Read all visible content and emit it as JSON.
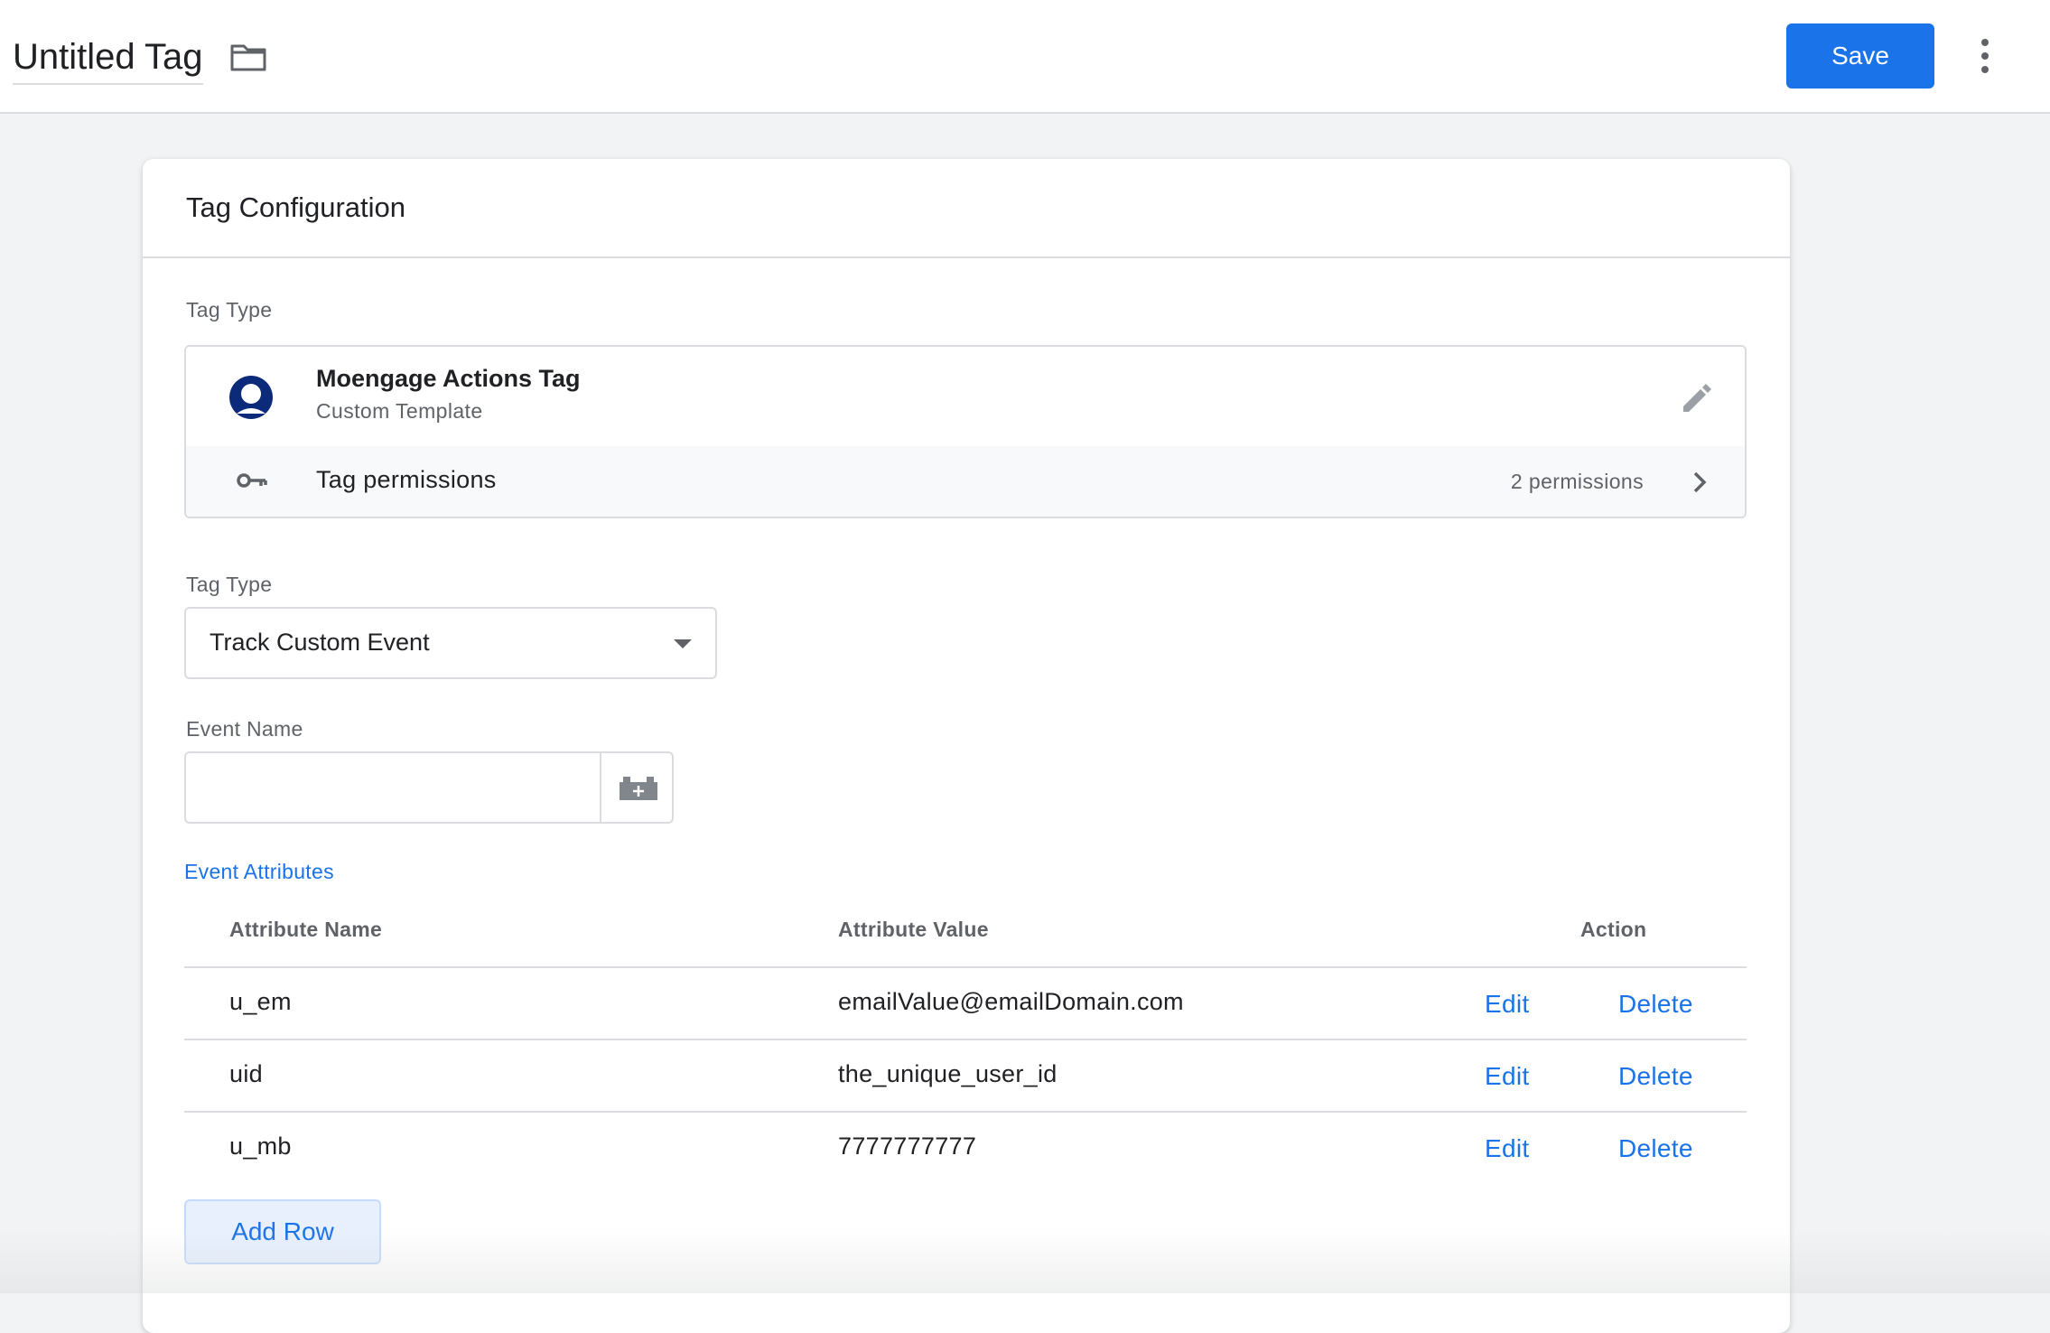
{
  "header": {
    "title": "Untitled Tag",
    "save_label": "Save",
    "accent_color": "#1a73e8"
  },
  "card": {
    "title": "Tag Configuration",
    "tag_type_label": "Tag Type",
    "template": {
      "name": "Moengage Actions Tag",
      "subtitle": "Custom Template",
      "icon": "moengage-avatar-icon",
      "icon_color": "#0b2a7a"
    },
    "permissions": {
      "label": "Tag permissions",
      "count_text": "2 permissions"
    },
    "tag_type_select": {
      "label": "Tag Type",
      "value": "Track Custom Event"
    },
    "event_name": {
      "label": "Event Name",
      "value": ""
    },
    "attributes": {
      "section_label": "Event Attributes",
      "columns": [
        "Attribute Name",
        "Attribute Value",
        "Action"
      ],
      "rows": [
        {
          "name": "u_em",
          "value": "emailValue@emailDomain.com",
          "edit": "Edit",
          "delete": "Delete"
        },
        {
          "name": "uid",
          "value": "the_unique_user_id",
          "edit": "Edit",
          "delete": "Delete"
        },
        {
          "name": "u_mb",
          "value": "7777777777",
          "edit": "Edit",
          "delete": "Delete"
        }
      ],
      "add_row_label": "Add Row"
    }
  }
}
